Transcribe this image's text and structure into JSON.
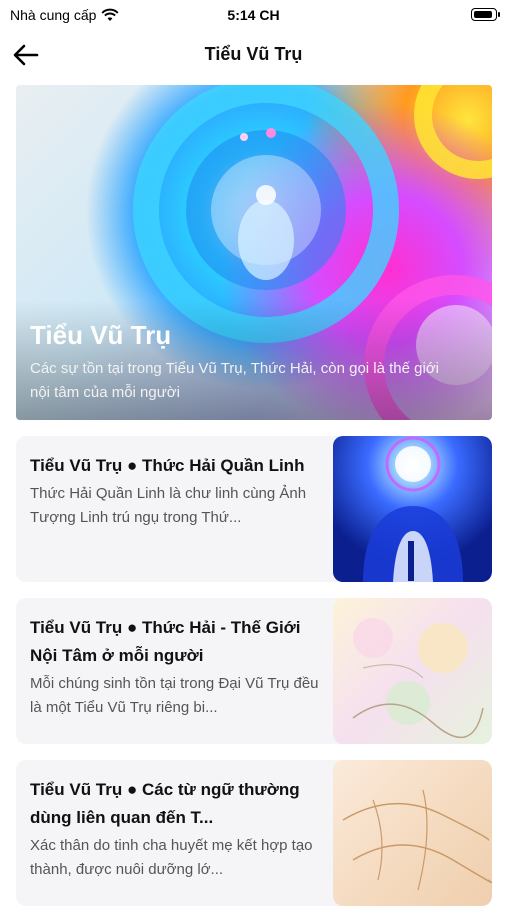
{
  "status_bar": {
    "carrier": "Nhà cung cấp",
    "time": "5:14 CH",
    "battery_level": 0.9
  },
  "nav": {
    "title": "Tiểu Vũ Trụ",
    "back_icon": "arrow-left-icon"
  },
  "hero": {
    "title": "Tiểu Vũ Trụ",
    "subtitle": "Các sự tồn tại trong Tiểu Vũ Trụ, Thức Hải, còn gọi là thế giới nội tâm của mỗi người"
  },
  "articles": [
    {
      "title": "Tiểu Vũ Trụ ● Thức Hải Quần Linh",
      "description": "Thức Hải Quần Linh là chư linh cùng Ảnh Tượng Linh trú ngụ trong Thứ...",
      "thumb_colors": [
        "#0b1f8f",
        "#3a6bff",
        "#ffffff"
      ]
    },
    {
      "title": "Tiểu Vũ Trụ ● Thức Hải - Thế Giới Nội Tâm ở mỗi người",
      "description": "Mỗi chúng sinh tồn tại trong Đại Vũ Trụ đều là một Tiểu Vũ Trụ riêng bi...",
      "thumb_colors": [
        "#fdf3d9",
        "#f5e0ef",
        "#d9ecd3"
      ]
    },
    {
      "title": "Tiểu Vũ Trụ ● Các từ ngữ thường dùng liên quan đến T...",
      "description": "Xác thân do tinh cha huyết mẹ kết hợp tạo thành, được nuôi dưỡng lớ...",
      "thumb_colors": [
        "#f7dfc4",
        "#f0d0aa",
        "#c99a67"
      ]
    }
  ]
}
